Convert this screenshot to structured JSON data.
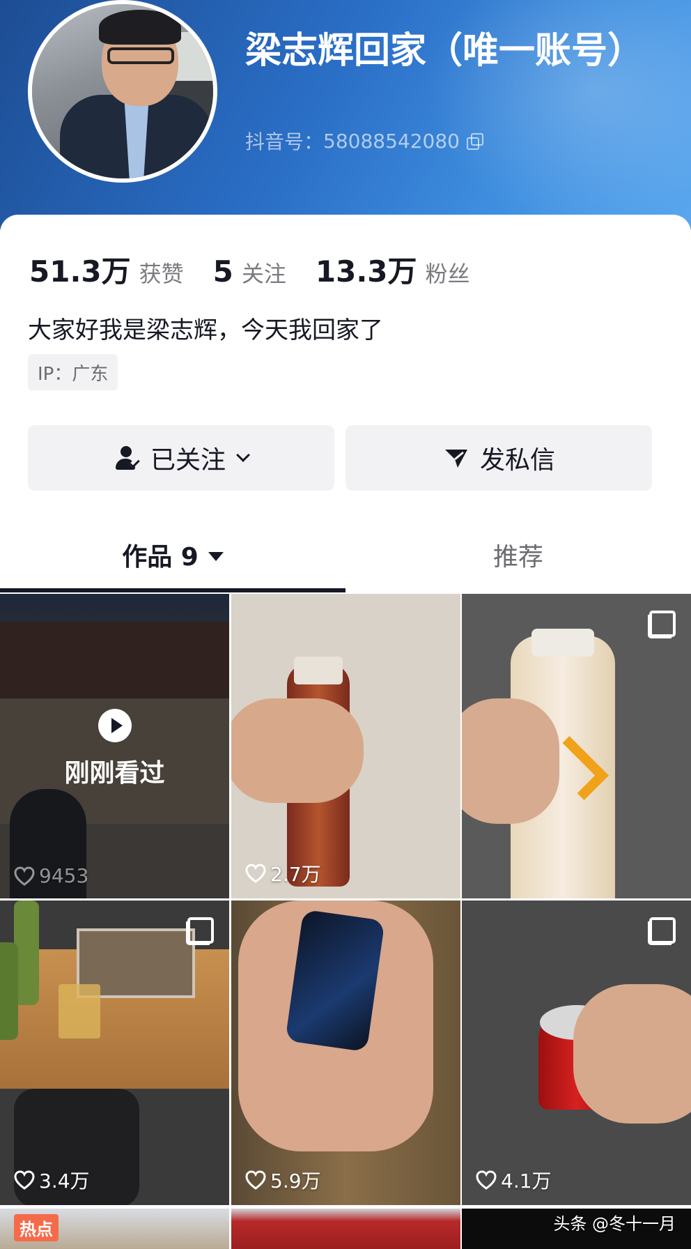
{
  "profile": {
    "name": "梁志辉回家（唯一账号）",
    "account_label": "抖音号：",
    "account_id": "58088542080"
  },
  "stats": {
    "likes_value": "51.3万",
    "likes_label": "获赞",
    "following_value": "5",
    "following_label": "关注",
    "followers_value": "13.3万",
    "followers_label": "粉丝"
  },
  "bio": "大家好我是梁志辉，今天我回家了",
  "ip": "IP：广东",
  "buttons": {
    "follow_label": "已关注",
    "message_label": "发私信"
  },
  "tabs": {
    "works_label": "作品 9",
    "recommend_label": "推荐"
  },
  "grid": {
    "seen_label": "刚刚看过",
    "likes": [
      "9453",
      "2.7万",
      "",
      "3.4万",
      "5.9万",
      "4.1万"
    ],
    "hot_tag": "热点"
  },
  "watermark": "头条 @冬十一月"
}
